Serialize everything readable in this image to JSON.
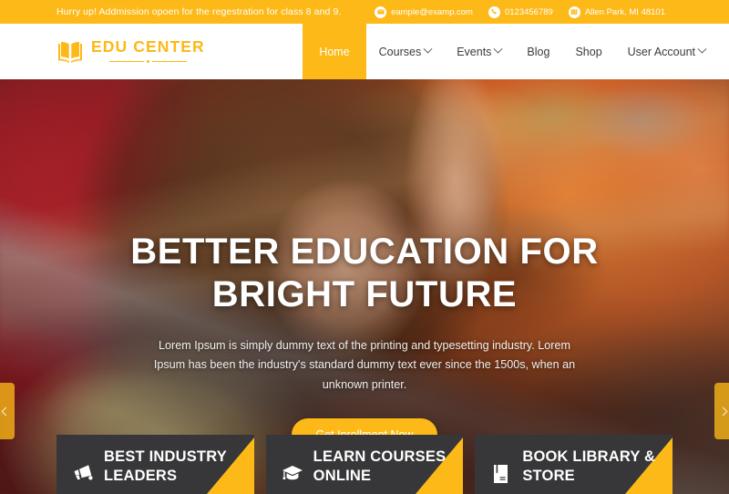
{
  "topbar": {
    "notice": "Hurry up! Addmission opoen for the regestration for class 8 and 9.",
    "contacts": [
      {
        "icon": "envelope-icon",
        "label": "eample@examp.com"
      },
      {
        "icon": "phone-icon",
        "label": "0123456789"
      },
      {
        "icon": "map-icon",
        "label": "Allen Park, MI 48101"
      }
    ],
    "bg_color": "#fcb917"
  },
  "header": {
    "logo": {
      "icon": "open-book-icon",
      "text": "EDU CENTER",
      "color": "#fcb917"
    },
    "nav": [
      {
        "label": "Home",
        "active": true,
        "has_dropdown": false
      },
      {
        "label": "Courses",
        "active": false,
        "has_dropdown": true
      },
      {
        "label": "Events",
        "active": false,
        "has_dropdown": true
      },
      {
        "label": "Blog",
        "active": false,
        "has_dropdown": false
      },
      {
        "label": "Shop",
        "active": false,
        "has_dropdown": false
      },
      {
        "label": "User Account",
        "active": false,
        "has_dropdown": true
      }
    ]
  },
  "hero": {
    "title_line1": "BETTER EDUCATION FOR",
    "title_line2": "BRIGHT FUTURE",
    "subtitle": "Lorem Ipsum is simply dummy text of the printing and typesetting industry. Lorem Ipsum has been the industry's standard dummy text ever since the 1500s, when an unknown printer.",
    "cta_label": "Get Inrollment Now",
    "cta_color": "#fcb917",
    "prev_arrow": "chevron-left-icon",
    "next_arrow": "chevron-right-icon"
  },
  "features": [
    {
      "icon": "megaphone-icon",
      "line1": "BEST INDUSTRY",
      "line2": "LEADERS"
    },
    {
      "icon": "graduation-cap-icon",
      "line1": "LEARN COURSES",
      "line2": "ONLINE"
    },
    {
      "icon": "book-icon",
      "line1": "BOOK LIBRARY &",
      "line2": "STORE"
    }
  ],
  "theme": {
    "accent": "#fcb917",
    "card_bg": "#373739",
    "text_dark": "#3b3b3b"
  }
}
